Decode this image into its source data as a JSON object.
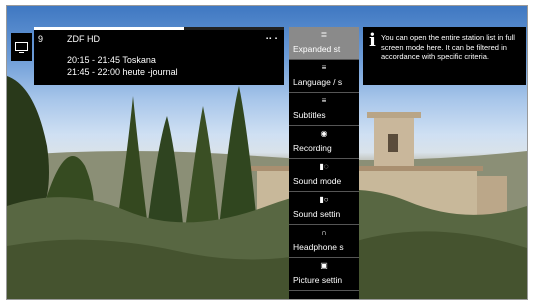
{
  "channel": {
    "number": "9",
    "name": "ZDF HD",
    "badges": "▪▪ ▪",
    "progress": 0.6,
    "programmes": [
      "20:15 - 21:45  Toskana",
      "21:45 - 22:00  heute -journal"
    ]
  },
  "menu": {
    "items": [
      {
        "label": "Expanded st",
        "icon": "≣"
      },
      {
        "label": "Language / s",
        "icon": "≡"
      },
      {
        "label": "Subtitles",
        "icon": "≡"
      },
      {
        "label": "Recording",
        "icon": "◉"
      },
      {
        "label": "Sound mode",
        "icon": "▮◌"
      },
      {
        "label": "Sound settin",
        "icon": "▮○"
      },
      {
        "label": "Headphone s",
        "icon": "∩"
      },
      {
        "label": "Picture settin",
        "icon": "▣"
      }
    ]
  },
  "tooltip": {
    "icon": "i",
    "text": "You can open the entire station list in full screen mode here. It can be filtered in accordance with specific criteria."
  },
  "icons": {
    "tv": "tv-icon",
    "info": "info-icon"
  }
}
